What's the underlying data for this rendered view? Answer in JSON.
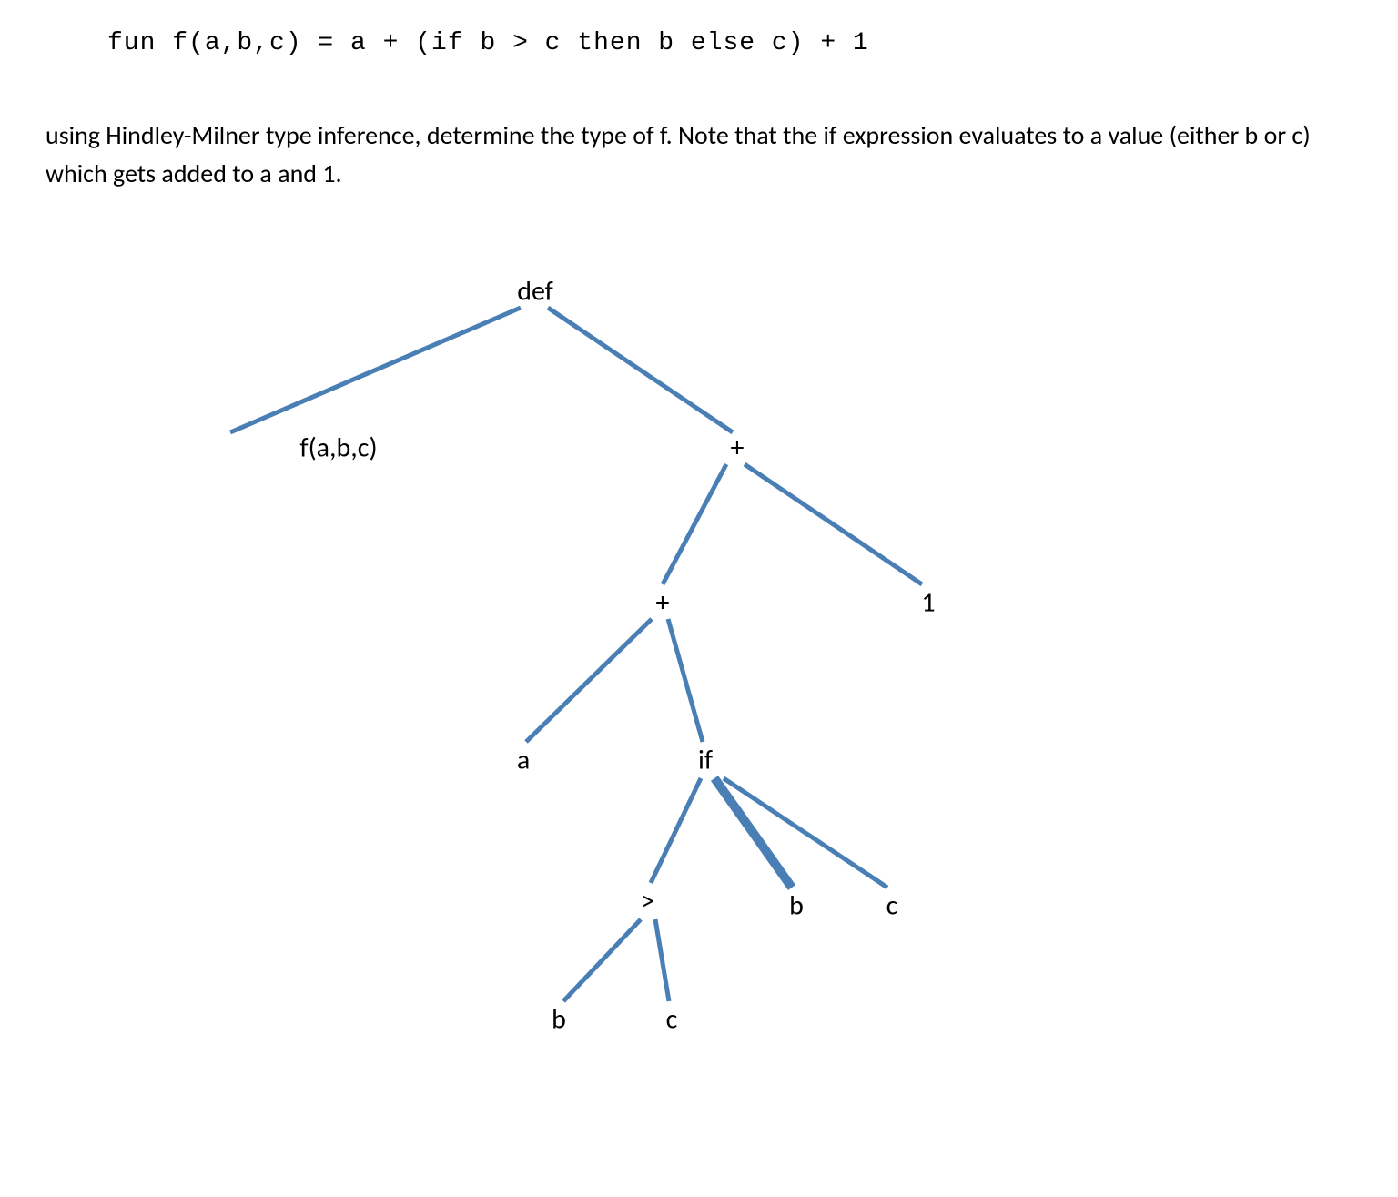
{
  "code": "fun f(a,b,c) =  a + (if b > c then b else c) + 1",
  "description": "using Hindley-Milner type inference, determine the type of f. Note that the if expression evaluates to a value (either b or c) which gets added to a and 1.",
  "tree": {
    "nodes": {
      "def": "def",
      "fabc": "f(a,b,c)",
      "plus1": "+",
      "plus2": "+",
      "one": "1",
      "a": "a",
      "if": "if",
      "gt": ">",
      "b1": "b",
      "c1": "c",
      "b2": "b",
      "c2": "c"
    }
  }
}
